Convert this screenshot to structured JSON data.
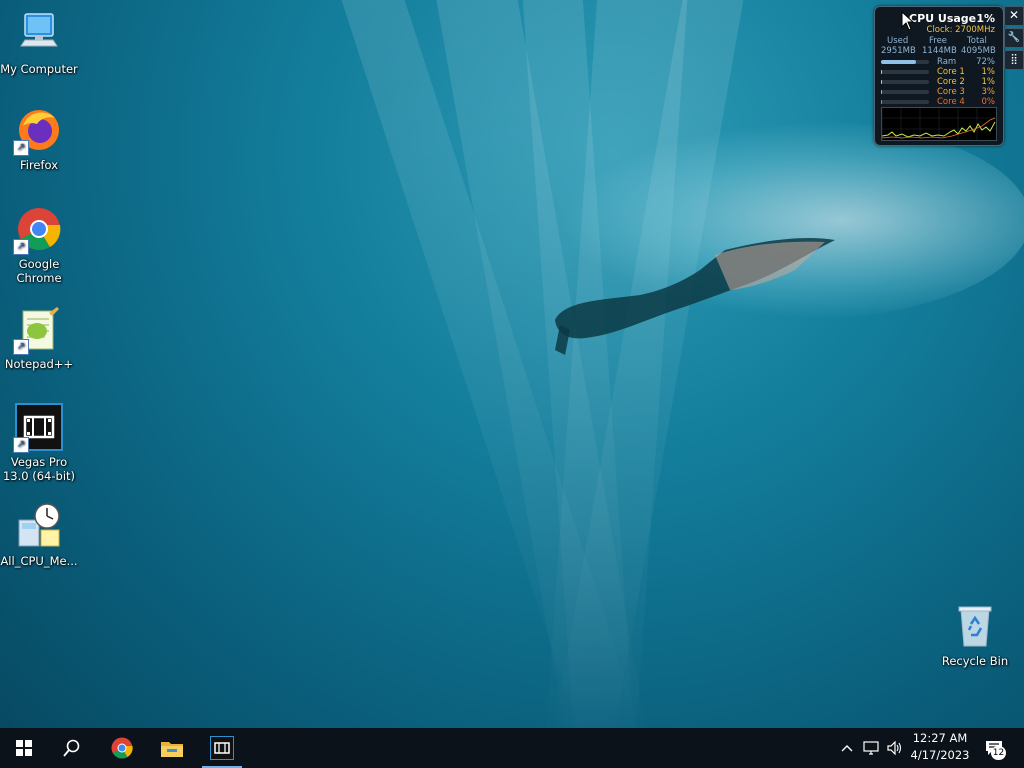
{
  "desktop": {
    "icons": [
      {
        "label": "My Computer",
        "icon": "computer-icon"
      },
      {
        "label": "Firefox",
        "icon": "firefox-icon"
      },
      {
        "label": "Google Chrome",
        "icon": "chrome-icon"
      },
      {
        "label": "Notepad++",
        "icon": "notepadpp-icon"
      },
      {
        "label": "Vegas Pro 13.0 (64-bit)",
        "icon": "vegas-pro-icon"
      },
      {
        "label": "All_CPU_Me...",
        "icon": "cpu-meter-icon"
      }
    ],
    "recycle_bin": {
      "label": "Recycle Bin",
      "icon": "recycle-bin-icon"
    }
  },
  "gadget": {
    "title": "CPU Usage",
    "cpu_percent": "1%",
    "clock": "Clock: 2700MHz",
    "headers": {
      "used": "Used",
      "free": "Free",
      "total": "Total"
    },
    "values": {
      "used": "2951MB",
      "free": "1144MB",
      "total": "4095MB"
    },
    "rows": [
      {
        "name": "Ram",
        "value": "72%",
        "fill": 0.72,
        "color": "#8fb7d4"
      },
      {
        "name": "Core 1",
        "value": "1%",
        "fill": 0.01,
        "color": "#f0c24a"
      },
      {
        "name": "Core 2",
        "value": "1%",
        "fill": 0.01,
        "color": "#f0c24a"
      },
      {
        "name": "Core 3",
        "value": "3%",
        "fill": 0.03,
        "color": "#f0a040"
      },
      {
        "name": "Core 4",
        "value": "0%",
        "fill": 0.0,
        "color": "#e8742e"
      }
    ],
    "buttons": {
      "close": "✕",
      "settings": "🔧",
      "drag": "⣿"
    }
  },
  "taskbar": {
    "pinned": [
      "start-icon",
      "search-icon",
      "chrome-icon",
      "file-explorer-icon",
      "vegas-pro-icon"
    ],
    "time": "12:27 AM",
    "date": "4/17/2023",
    "notification_count": "12"
  },
  "colors": {
    "taskbar": "#0b1219",
    "accent": "#6fb1e8",
    "gadget_bg": "#0f1720"
  }
}
